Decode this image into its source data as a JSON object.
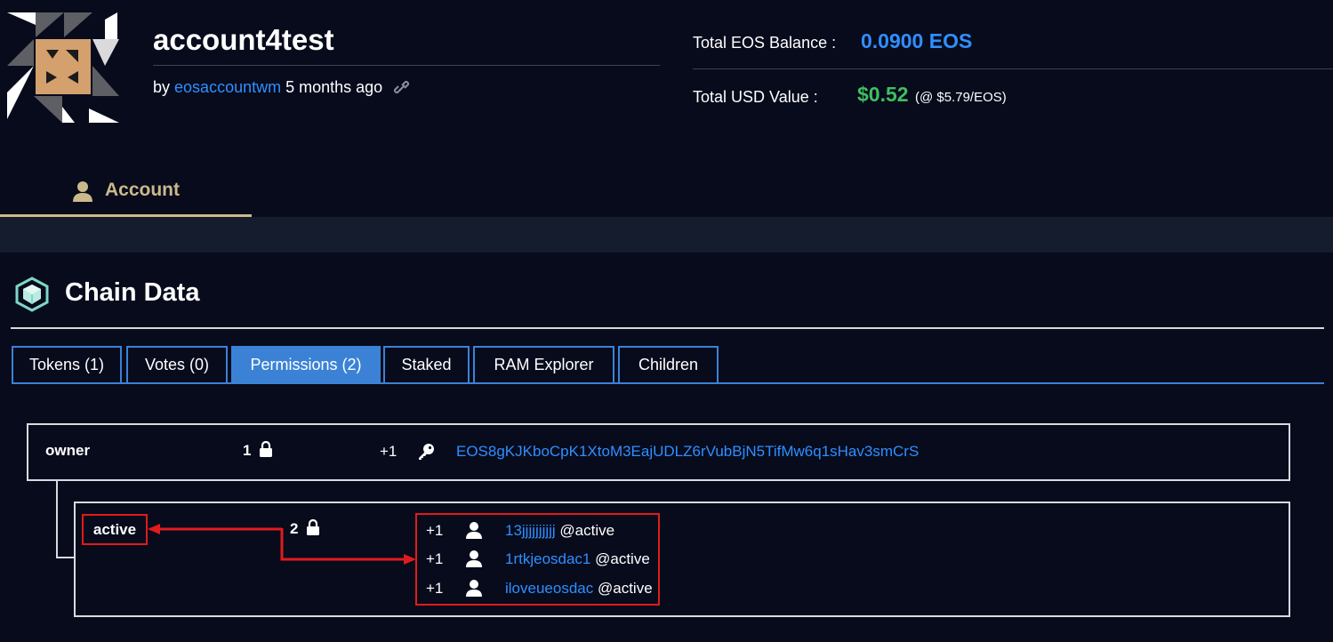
{
  "account": {
    "name": "account4test",
    "by_prefix": "by",
    "creator": "eosaccountwm",
    "created_ago": "5 months ago",
    "avatar_icon": "identicon-avatar",
    "link_icon": "link-icon"
  },
  "balance": {
    "total_eos_label": "Total EOS Balance :",
    "total_eos_value": "0.0900 EOS",
    "total_usd_label": "Total USD Value :",
    "total_usd_value": "$0.52",
    "usd_rate": "(@ $5.79/EOS)"
  },
  "nav": {
    "account_tab": "Account",
    "account_icon": "user-icon"
  },
  "chain": {
    "title": "Chain Data",
    "icon": "cube-network-icon",
    "tabs": [
      {
        "label": "Tokens (1)",
        "active": false
      },
      {
        "label": "Votes (0)",
        "active": false
      },
      {
        "label": "Permissions (2)",
        "active": true
      },
      {
        "label": "Staked",
        "active": false
      },
      {
        "label": "RAM Explorer",
        "active": false
      },
      {
        "label": "Children",
        "active": false
      }
    ]
  },
  "permissions": {
    "owner": {
      "name": "owner",
      "threshold": "1",
      "keys": [
        {
          "weight": "+1",
          "key": "EOS8gKJKboCpK1XtoM3EajUDLZ6rVubBjN5TifMw6q1sHav3smCrS",
          "icon": "key-icon"
        }
      ]
    },
    "active": {
      "name": "active",
      "threshold": "2",
      "accounts": [
        {
          "weight": "+1",
          "actor": "13jjjjjjjjjj",
          "permission": "@active",
          "icon": "user-icon"
        },
        {
          "weight": "+1",
          "actor": "1rtkjeosdac1",
          "permission": "@active",
          "icon": "user-icon"
        },
        {
          "weight": "+1",
          "actor": "iloveueosdac",
          "permission": "@active",
          "icon": "user-icon"
        }
      ]
    }
  },
  "colors": {
    "background": "#070b1c",
    "link": "#2f8fff",
    "eos_balance": "#2f8fff",
    "usd_value": "#3fbf5f",
    "tab_accent": "#3b82d6",
    "account_tab": "#cbb98b",
    "annotation": "#e01b1b"
  }
}
